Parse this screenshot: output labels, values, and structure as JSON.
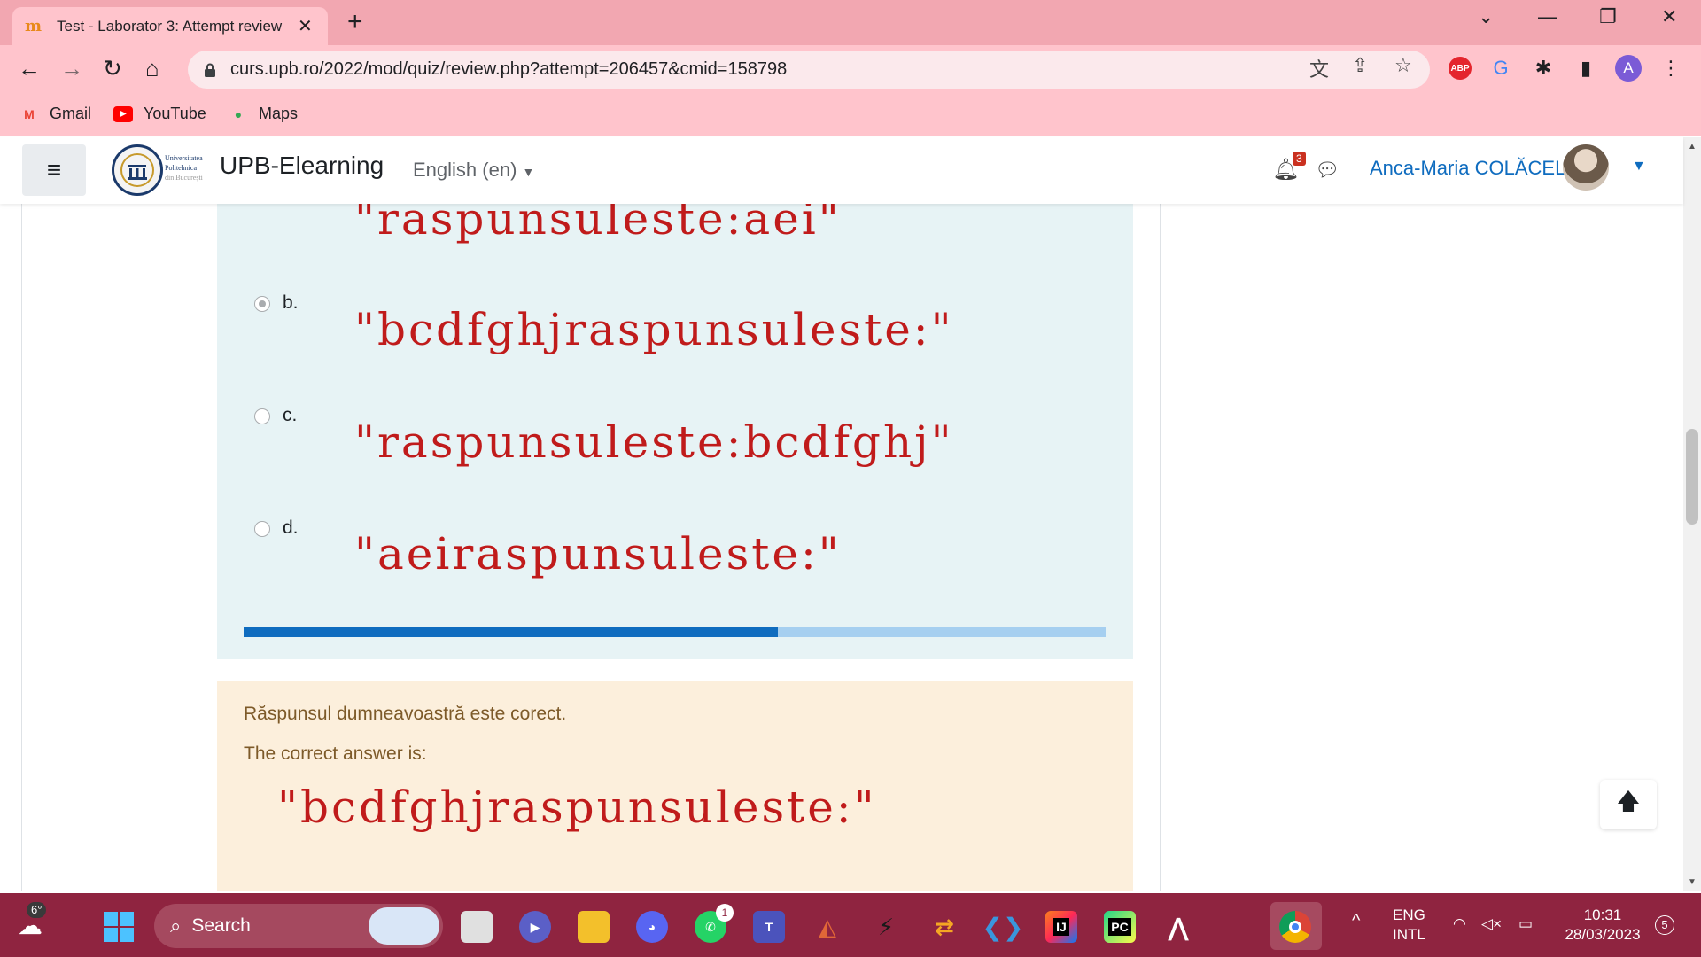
{
  "browser": {
    "tab_title": "Test - Laborator 3: Attempt review",
    "tab_close": "✕",
    "new_tab": "+",
    "url": "curs.upb.ro/2022/mod/quiz/review.php?attempt=206457&cmid=158798",
    "window_controls": {
      "minimize": "—",
      "maximize": "❐",
      "close": "✕",
      "tabsearch": "⌄"
    },
    "bookmarks": [
      {
        "label": "Gmail",
        "icon": "gmail-icon"
      },
      {
        "label": "YouTube",
        "icon": "youtube-icon"
      },
      {
        "label": "Maps",
        "icon": "maps-icon"
      }
    ],
    "extensions": {
      "abp": "ABP",
      "profile": "A"
    }
  },
  "moodle": {
    "site_name": "UPB-Elearning",
    "logo_text": [
      "Universitatea",
      "Politehnica",
      "din București"
    ],
    "language": "English (en)",
    "notification_count": "3",
    "user_name": "Anca-Maria COLĂCEL",
    "question": {
      "partial_option_text": "\"raspunsuleste:aei\"",
      "options": [
        {
          "letter": "b.",
          "text": "\"bcdfghjraspunsuleste:\"",
          "selected": true
        },
        {
          "letter": "c.",
          "text": "\"raspunsuleste:bcdfghj\"",
          "selected": false
        },
        {
          "letter": "d.",
          "text": "\"aeiraspunsuleste:\"",
          "selected": false
        }
      ],
      "progress": 0.62
    },
    "feedback": {
      "status": "Răspunsul dumneavoastră este corect.",
      "correct_label": "The correct answer is:",
      "correct_answer": "\"bcdfghjraspunsuleste:\""
    }
  },
  "taskbar": {
    "weather": "6°",
    "search_label": "Search",
    "whatsapp_badge": "1",
    "intellij_label": "IJ",
    "pycharm_label": "PC",
    "lang_line1": "ENG",
    "lang_line2": "INTL",
    "time": "10:31",
    "date": "28/03/2023",
    "notification_count": "5"
  },
  "colors": {
    "tab_bar": "#f2a7b1",
    "toolbar": "#ffc4cc",
    "taskbar": "#8f2440",
    "question_bg": "#e7f3f5",
    "feedback_bg": "#fcefdc",
    "formula_red": "#c01b1b",
    "moodle_blue": "#0f6cbf"
  }
}
